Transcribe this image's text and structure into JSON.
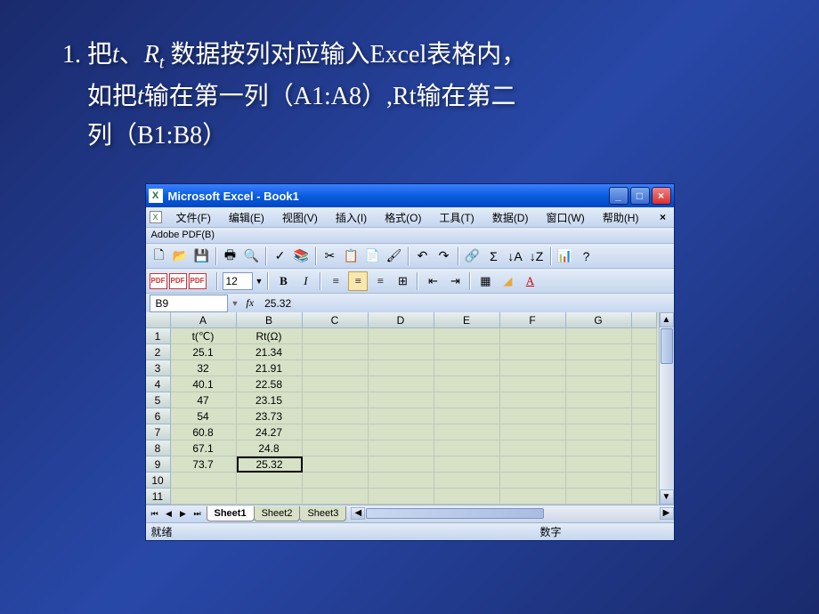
{
  "slide": {
    "line1_prefix": "1. 把",
    "var_t": "t",
    "sep1": "、",
    "var_R": "R",
    "var_R_sub": "t",
    "line1_suffix": " 数据按列对应输入Excel表格内，",
    "line2_prefix": "如把",
    "line2_mid": "输在第一列（A1:A8）,Rt输在第二",
    "line3": "列（B1:B8）"
  },
  "window": {
    "title": "Microsoft Excel - Book1"
  },
  "menu": {
    "file": "文件(F)",
    "edit": "编辑(E)",
    "view": "视图(V)",
    "insert": "插入(I)",
    "format": "格式(O)",
    "tools": "工具(T)",
    "data": "数据(D)",
    "window": "窗口(W)",
    "help": "帮助(H)"
  },
  "pdf_label": "Adobe PDF(B)",
  "format_bar": {
    "font_size": "12"
  },
  "formula": {
    "cell_ref": "B9",
    "fx": "fx",
    "value": "25.32"
  },
  "columns": [
    "A",
    "B",
    "C",
    "D",
    "E",
    "F",
    "G"
  ],
  "rows": [
    "1",
    "2",
    "3",
    "4",
    "5",
    "6",
    "7",
    "8",
    "9",
    "10",
    "11"
  ],
  "grid": {
    "A1": "t(℃)",
    "B1": "Rt(Ω)",
    "A2": "25.1",
    "B2": "21.34",
    "A3": "32",
    "B3": "21.91",
    "A4": "40.1",
    "B4": "22.58",
    "A5": "47",
    "B5": "23.15",
    "A6": "54",
    "B6": "23.73",
    "A7": "60.8",
    "B7": "24.27",
    "A8": "67.1",
    "B8": "24.8",
    "A9": "73.7",
    "B9": "25.32"
  },
  "tabs": {
    "s1": "Sheet1",
    "s2": "Sheet2",
    "s3": "Sheet3"
  },
  "status": {
    "left": "就绪",
    "right": "数字"
  },
  "chart_data": {
    "type": "table",
    "columns": [
      "t(℃)",
      "Rt(Ω)"
    ],
    "rows": [
      [
        25.1,
        21.34
      ],
      [
        32,
        21.91
      ],
      [
        40.1,
        22.58
      ],
      [
        47,
        23.15
      ],
      [
        54,
        23.73
      ],
      [
        60.8,
        24.27
      ],
      [
        67.1,
        24.8
      ],
      [
        73.7,
        25.32
      ]
    ]
  }
}
